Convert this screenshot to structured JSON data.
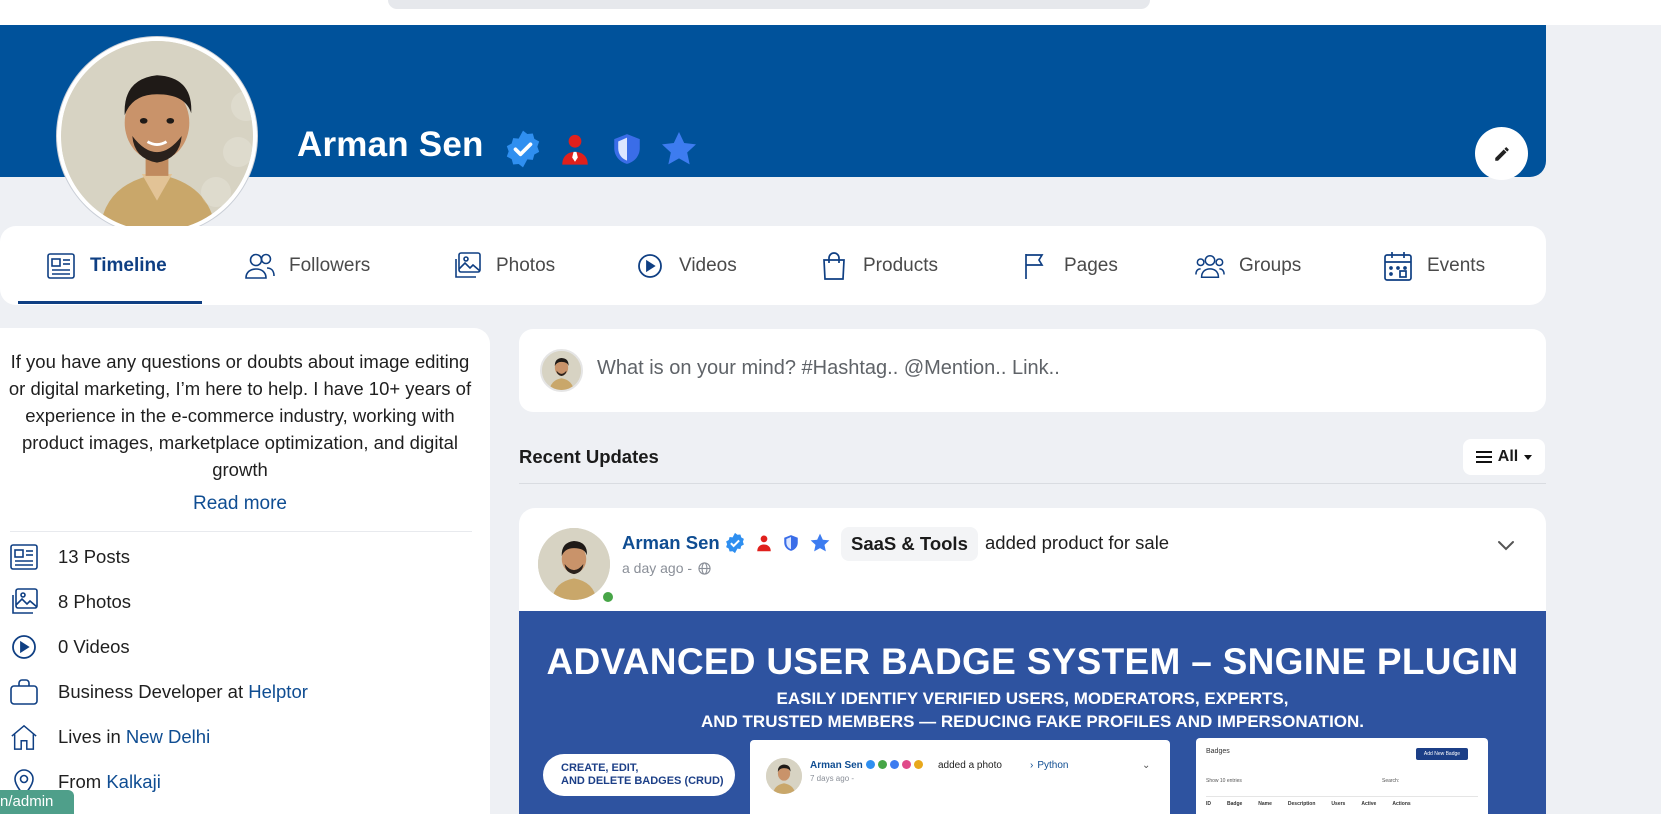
{
  "profile": {
    "name": "Arman Sen",
    "badges": [
      "verified-check-icon",
      "admin-user-icon",
      "moderator-shield-icon",
      "star-icon"
    ]
  },
  "colors": {
    "brand": "#00529b",
    "link": "#0f4d92",
    "promo": "#2e53a0",
    "online": "#47a547"
  },
  "tabs": [
    {
      "label": "Timeline",
      "icon": "newspaper-icon",
      "active": true
    },
    {
      "label": "Followers",
      "icon": "users-icon"
    },
    {
      "label": "Photos",
      "icon": "photos-icon"
    },
    {
      "label": "Videos",
      "icon": "play-circle-icon"
    },
    {
      "label": "Products",
      "icon": "shopping-bag-icon"
    },
    {
      "label": "Pages",
      "icon": "flag-icon"
    },
    {
      "label": "Groups",
      "icon": "group-icon"
    },
    {
      "label": "Events",
      "icon": "calendar-icon"
    }
  ],
  "about": {
    "bio": "If you have any questions or doubts about image editing or digital marketing, I’m here to help. I have 10+ years of experience in the e-commerce industry, working with product images, marketplace optimization, and digital growth",
    "read_more": "Read more",
    "stats": [
      {
        "icon": "newspaper-icon",
        "text": "13 Posts"
      },
      {
        "icon": "photos-icon",
        "text": "8 Photos"
      },
      {
        "icon": "play-circle-icon",
        "text": "0 Videos"
      }
    ],
    "work": {
      "prefix": "Business Developer at ",
      "link": "Helptor"
    },
    "lives": {
      "prefix": "Lives in ",
      "link": "New Delhi"
    },
    "from": {
      "prefix": "From ",
      "link": "Kalkaji"
    }
  },
  "composer": {
    "placeholder": "What is on your mind? #Hashtag.. @Mention.. Link.."
  },
  "feed": {
    "title": "Recent Updates",
    "filter_label": "All"
  },
  "post": {
    "author": "Arman Sen",
    "chip": "SaaS & Tools",
    "action": "added product for sale",
    "time": "a day ago -",
    "promo": {
      "headline": "ADVANCED USER BADGE SYSTEM – SNGINE PLUGIN",
      "sub1": "EASILY IDENTIFY VERIFIED USERS, MODERATORS, EXPERTS,",
      "sub2": "AND TRUSTED MEMBERS — REDUCING FAKE PROFILES AND IMPERSONATION.",
      "pill1": "CREATE, EDIT,",
      "pill2": "AND DELETE BADGES (CRUD)",
      "card_name": "Arman Sen",
      "card_action": "added a photo",
      "card_group": "Python",
      "card_time": "7 days ago -",
      "table_title": "Badges",
      "add_label": "Add New Badge",
      "show_label": "Show",
      "entries_label": "entries",
      "search_label": "Search:",
      "columns": [
        "ID",
        "Badge",
        "Name",
        "Description",
        "Users",
        "Active",
        "Actions"
      ]
    }
  },
  "status_url": "n/admin"
}
